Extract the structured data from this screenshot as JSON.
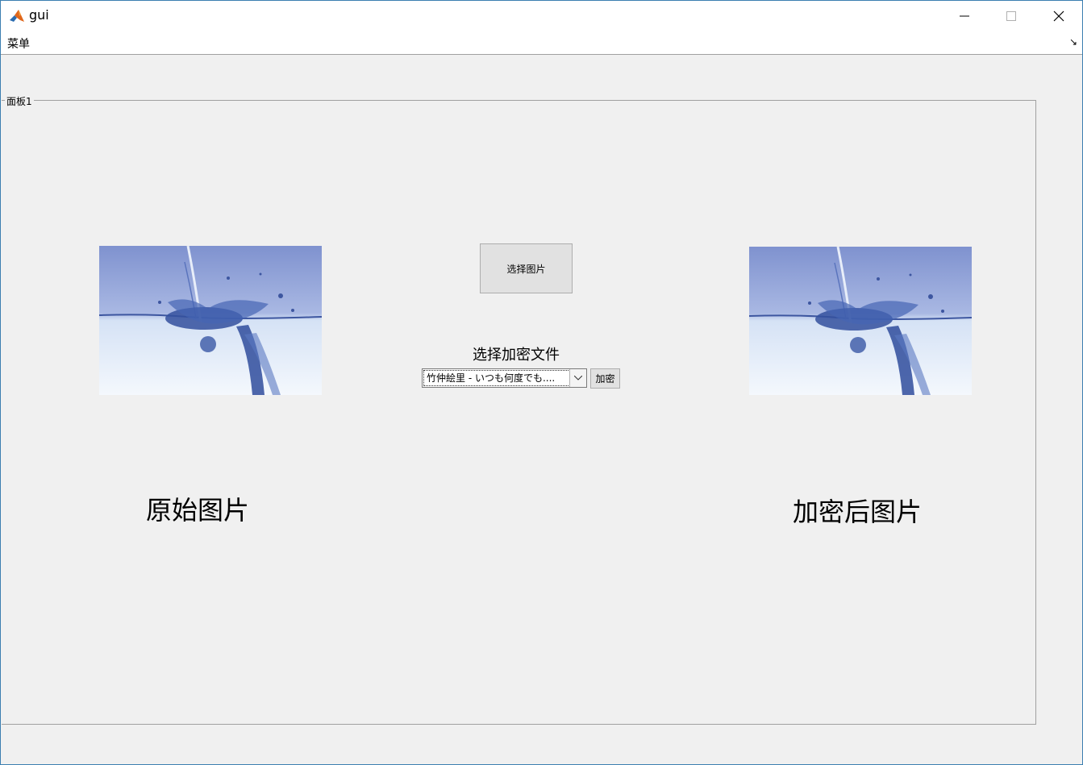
{
  "window": {
    "title": "gui",
    "controls": [
      "minimize-icon",
      "maximize-icon",
      "close-icon"
    ]
  },
  "menubar": {
    "menu_label": "菜单",
    "toolbar_toggle": "↘"
  },
  "panel": {
    "title": "面板1",
    "select_image_button": "选择图片",
    "select_file_label": "选择加密文件",
    "file_dropdown": {
      "selected": "竹仲絵里 - いつも何度でも...."
    },
    "encrypt_button": "加密",
    "original_caption": "原始图片",
    "encrypted_caption": "加密后图片"
  },
  "colors": {
    "accent_border": "#3c7fb1",
    "background": "#f0f0f0",
    "button_face": "#e1e1e1"
  }
}
